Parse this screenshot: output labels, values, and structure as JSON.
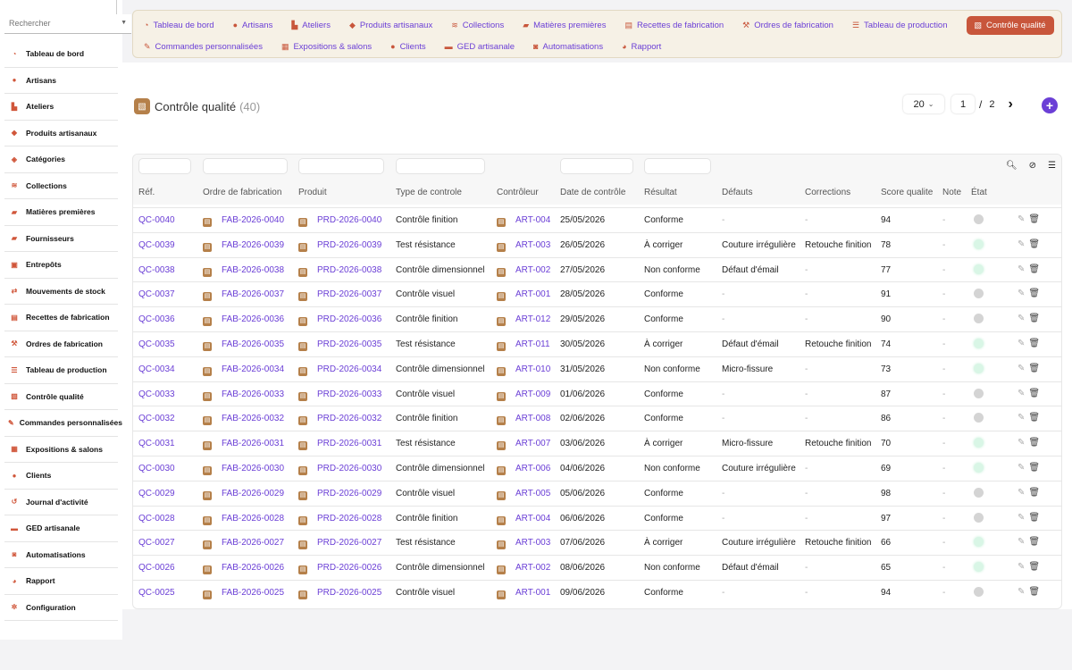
{
  "search": {
    "placeholder": "Rechercher"
  },
  "sidebar": {
    "items": [
      {
        "label": "Tableau de bord",
        "icon": "dashboard-icon",
        "glyph": "◔"
      },
      {
        "label": "Artisans",
        "icon": "user-icon",
        "glyph": "●"
      },
      {
        "label": "Ateliers",
        "icon": "chart-icon",
        "glyph": "▙"
      },
      {
        "label": "Produits artisanaux",
        "icon": "gem-icon",
        "glyph": "◆"
      },
      {
        "label": "Catégories",
        "icon": "tags-icon",
        "glyph": "◈"
      },
      {
        "label": "Collections",
        "icon": "layers-icon",
        "glyph": "≋"
      },
      {
        "label": "Matières premières",
        "icon": "truck-icon",
        "glyph": "▰"
      },
      {
        "label": "Fournisseurs",
        "icon": "truck-icon",
        "glyph": "▰"
      },
      {
        "label": "Entrepôts",
        "icon": "warehouse-icon",
        "glyph": "▣"
      },
      {
        "label": "Mouvements de stock",
        "icon": "exchange-icon",
        "glyph": "⇄"
      },
      {
        "label": "Recettes de fabrication",
        "icon": "recipe-icon",
        "glyph": "▤"
      },
      {
        "label": "Ordres de fabrication",
        "icon": "hammer-icon",
        "glyph": "⚒"
      },
      {
        "label": "Tableau de production",
        "icon": "list-icon",
        "glyph": "☰"
      },
      {
        "label": "Contrôle qualité",
        "icon": "clipboard-check-icon",
        "glyph": "▧"
      },
      {
        "label": "Commandes personnalisées",
        "icon": "pencil-icon",
        "glyph": "✎"
      },
      {
        "label": "Expositions & salons",
        "icon": "calendar-icon",
        "glyph": "▦"
      },
      {
        "label": "Clients",
        "icon": "users-icon",
        "glyph": "●"
      },
      {
        "label": "Journal d'activité",
        "icon": "history-icon",
        "glyph": "↺"
      },
      {
        "label": "GED artisanale",
        "icon": "folder-icon",
        "glyph": "▬"
      },
      {
        "label": "Automatisations",
        "icon": "robot-icon",
        "glyph": "◙"
      },
      {
        "label": "Rapport",
        "icon": "pie-chart-icon",
        "glyph": "◕"
      },
      {
        "label": "Configuration",
        "icon": "gear-icon",
        "glyph": "✲"
      }
    ]
  },
  "topnav": {
    "row1": [
      {
        "label": "Tableau de bord",
        "icon": "dashboard-icon",
        "glyph": "◔"
      },
      {
        "label": "Artisans",
        "icon": "user-icon",
        "glyph": "●"
      },
      {
        "label": "Ateliers",
        "icon": "chart-icon",
        "glyph": "▙"
      },
      {
        "label": "Produits artisanaux",
        "icon": "gem-icon",
        "glyph": "◆"
      },
      {
        "label": "Collections",
        "icon": "layers-icon",
        "glyph": "≋"
      },
      {
        "label": "Matières premières",
        "icon": "truck-icon",
        "glyph": "▰"
      },
      {
        "label": "Recettes de fabrication",
        "icon": "recipe-icon",
        "glyph": "▤"
      },
      {
        "label": "Ordres de fabrication",
        "icon": "hammer-icon",
        "glyph": "⚒"
      },
      {
        "label": "Tableau de production",
        "icon": "list-icon",
        "glyph": "☰"
      },
      {
        "label": "Contrôle qualité",
        "icon": "clipboard-check-icon",
        "glyph": "▧",
        "active": true
      }
    ],
    "row2": [
      {
        "label": "Commandes personnalisées",
        "icon": "pencil-icon",
        "glyph": "✎"
      },
      {
        "label": "Expositions & salons",
        "icon": "calendar-icon",
        "glyph": "▦"
      },
      {
        "label": "Clients",
        "icon": "users-icon",
        "glyph": "●"
      },
      {
        "label": "GED artisanale",
        "icon": "folder-icon",
        "glyph": "▬"
      },
      {
        "label": "Automatisations",
        "icon": "robot-icon",
        "glyph": "◙"
      },
      {
        "label": "Rapport",
        "icon": "pie-chart-icon",
        "glyph": "◕"
      }
    ]
  },
  "page": {
    "title": "Contrôle qualité",
    "count": "(40)",
    "per_page": "20",
    "current_page": "1",
    "page_sep": "/",
    "total_pages": "2"
  },
  "colors": {
    "accent": "#c8563b",
    "link": "#6b3fd6",
    "icon_brown": "#b5804a"
  },
  "table": {
    "columns": [
      "Réf.",
      "Ordre de fabrication",
      "Produit",
      "Type de controle",
      "Contrôleur",
      "Date de contrôle",
      "Résultat",
      "Défauts",
      "Corrections",
      "Score qualite",
      "Note",
      "État"
    ],
    "rows": [
      {
        "ref": "QC-0040",
        "of": "FAB-2026-0040",
        "produit": "PRD-2026-0040",
        "type": "Contrôle finition",
        "ctrl": "ART-004",
        "date": "25/05/2026",
        "resultat": "Conforme",
        "defauts": "-",
        "corrections": "-",
        "score": "94",
        "note": "-",
        "etat": "grey"
      },
      {
        "ref": "QC-0039",
        "of": "FAB-2026-0039",
        "produit": "PRD-2026-0039",
        "type": "Test résistance",
        "ctrl": "ART-003",
        "date": "26/05/2026",
        "resultat": "À corriger",
        "defauts": "Couture irrégulière",
        "corrections": "Retouche finition",
        "score": "78",
        "note": "-",
        "etat": "green"
      },
      {
        "ref": "QC-0038",
        "of": "FAB-2026-0038",
        "produit": "PRD-2026-0038",
        "type": "Contrôle dimensionnel",
        "ctrl": "ART-002",
        "date": "27/05/2026",
        "resultat": "Non conforme",
        "defauts": "Défaut d'émail",
        "corrections": "-",
        "score": "77",
        "note": "-",
        "etat": "green"
      },
      {
        "ref": "QC-0037",
        "of": "FAB-2026-0037",
        "produit": "PRD-2026-0037",
        "type": "Contrôle visuel",
        "ctrl": "ART-001",
        "date": "28/05/2026",
        "resultat": "Conforme",
        "defauts": "-",
        "corrections": "-",
        "score": "91",
        "note": "-",
        "etat": "grey"
      },
      {
        "ref": "QC-0036",
        "of": "FAB-2026-0036",
        "produit": "PRD-2026-0036",
        "type": "Contrôle finition",
        "ctrl": "ART-012",
        "date": "29/05/2026",
        "resultat": "Conforme",
        "defauts": "-",
        "corrections": "-",
        "score": "90",
        "note": "-",
        "etat": "grey"
      },
      {
        "ref": "QC-0035",
        "of": "FAB-2026-0035",
        "produit": "PRD-2026-0035",
        "type": "Test résistance",
        "ctrl": "ART-011",
        "date": "30/05/2026",
        "resultat": "À corriger",
        "defauts": "Défaut d'émail",
        "corrections": "Retouche finition",
        "score": "74",
        "note": "-",
        "etat": "green"
      },
      {
        "ref": "QC-0034",
        "of": "FAB-2026-0034",
        "produit": "PRD-2026-0034",
        "type": "Contrôle dimensionnel",
        "ctrl": "ART-010",
        "date": "31/05/2026",
        "resultat": "Non conforme",
        "defauts": "Micro-fissure",
        "corrections": "-",
        "score": "73",
        "note": "-",
        "etat": "green"
      },
      {
        "ref": "QC-0033",
        "of": "FAB-2026-0033",
        "produit": "PRD-2026-0033",
        "type": "Contrôle visuel",
        "ctrl": "ART-009",
        "date": "01/06/2026",
        "resultat": "Conforme",
        "defauts": "-",
        "corrections": "-",
        "score": "87",
        "note": "-",
        "etat": "grey"
      },
      {
        "ref": "QC-0032",
        "of": "FAB-2026-0032",
        "produit": "PRD-2026-0032",
        "type": "Contrôle finition",
        "ctrl": "ART-008",
        "date": "02/06/2026",
        "resultat": "Conforme",
        "defauts": "-",
        "corrections": "-",
        "score": "86",
        "note": "-",
        "etat": "grey"
      },
      {
        "ref": "QC-0031",
        "of": "FAB-2026-0031",
        "produit": "PRD-2026-0031",
        "type": "Test résistance",
        "ctrl": "ART-007",
        "date": "03/06/2026",
        "resultat": "À corriger",
        "defauts": "Micro-fissure",
        "corrections": "Retouche finition",
        "score": "70",
        "note": "-",
        "etat": "green"
      },
      {
        "ref": "QC-0030",
        "of": "FAB-2026-0030",
        "produit": "PRD-2026-0030",
        "type": "Contrôle dimensionnel",
        "ctrl": "ART-006",
        "date": "04/06/2026",
        "resultat": "Non conforme",
        "defauts": "Couture irrégulière",
        "corrections": "-",
        "score": "69",
        "note": "-",
        "etat": "green"
      },
      {
        "ref": "QC-0029",
        "of": "FAB-2026-0029",
        "produit": "PRD-2026-0029",
        "type": "Contrôle visuel",
        "ctrl": "ART-005",
        "date": "05/06/2026",
        "resultat": "Conforme",
        "defauts": "-",
        "corrections": "-",
        "score": "98",
        "note": "-",
        "etat": "grey"
      },
      {
        "ref": "QC-0028",
        "of": "FAB-2026-0028",
        "produit": "PRD-2026-0028",
        "type": "Contrôle finition",
        "ctrl": "ART-004",
        "date": "06/06/2026",
        "resultat": "Conforme",
        "defauts": "-",
        "corrections": "-",
        "score": "97",
        "note": "-",
        "etat": "grey"
      },
      {
        "ref": "QC-0027",
        "of": "FAB-2026-0027",
        "produit": "PRD-2026-0027",
        "type": "Test résistance",
        "ctrl": "ART-003",
        "date": "07/06/2026",
        "resultat": "À corriger",
        "defauts": "Couture irrégulière",
        "corrections": "Retouche finition",
        "score": "66",
        "note": "-",
        "etat": "green"
      },
      {
        "ref": "QC-0026",
        "of": "FAB-2026-0026",
        "produit": "PRD-2026-0026",
        "type": "Contrôle dimensionnel",
        "ctrl": "ART-002",
        "date": "08/06/2026",
        "resultat": "Non conforme",
        "defauts": "Défaut d'émail",
        "corrections": "-",
        "score": "65",
        "note": "-",
        "etat": "green"
      },
      {
        "ref": "QC-0025",
        "of": "FAB-2026-0025",
        "produit": "PRD-2026-0025",
        "type": "Contrôle visuel",
        "ctrl": "ART-001",
        "date": "09/06/2026",
        "resultat": "Conforme",
        "defauts": "-",
        "corrections": "-",
        "score": "94",
        "note": "-",
        "etat": "grey"
      }
    ]
  }
}
